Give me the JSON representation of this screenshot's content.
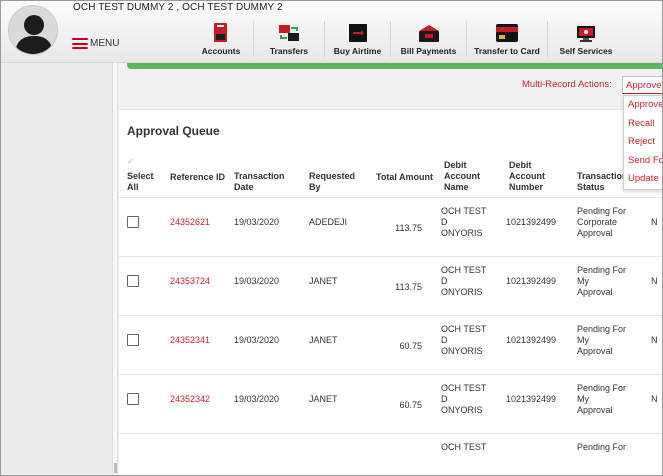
{
  "user": {
    "name": "OCH TEST DUMMY 2 , OCH TEST DUMMY 2"
  },
  "menu": {
    "label": "MENU"
  },
  "nav": [
    {
      "label": "Accounts",
      "icon": "accounts-icon"
    },
    {
      "label": "Transfers",
      "icon": "transfers-icon"
    },
    {
      "label": "Buy Airtime",
      "icon": "airtime-icon"
    },
    {
      "label": "Bill Payments",
      "icon": "bill-payments-icon"
    },
    {
      "label": "Transfer to Card",
      "icon": "card-icon"
    },
    {
      "label": "Self Services",
      "icon": "self-services-icon"
    }
  ],
  "multi_record": {
    "label": "Multi-Record Actions:",
    "selected": "Approve",
    "options": [
      "Approve",
      "Recall",
      "Reject",
      "Send For",
      "Update"
    ]
  },
  "queue": {
    "title": "Approval Queue",
    "columns": {
      "select": "Select All",
      "ref": "Reference ID",
      "date": "Transaction Date",
      "requested": "Requested By",
      "amount": "Total Amount",
      "debit_name": "Debit Account Name",
      "debit_number": "Debit Account Number",
      "status": "Transaction Status"
    },
    "rows": [
      {
        "ref": "24352621",
        "date": "19/03/2020",
        "requested": "ADEDEJI",
        "amount": "113.75",
        "name": [
          "OCH TEST",
          "D",
          "ONYORIS"
        ],
        "number": "1021392499",
        "status": [
          "Pending For",
          "Corporate",
          "Approval"
        ],
        "extra": "N"
      },
      {
        "ref": "24353724",
        "date": "19/03/2020",
        "requested": "JANET",
        "amount": "113.75",
        "name": [
          "OCH TEST",
          "D",
          "ONYORIS"
        ],
        "number": "1021392499",
        "status": [
          "Pending For",
          "My",
          "Approval"
        ],
        "extra": "N"
      },
      {
        "ref": "24352341",
        "date": "19/03/2020",
        "requested": "JANET",
        "amount": "60.75",
        "name": [
          "OCH TEST",
          "D",
          "ONYORIS"
        ],
        "number": "1021392499",
        "status": [
          "Pending For",
          "My",
          "Approval"
        ],
        "extra": "N"
      },
      {
        "ref": "24352342",
        "date": "19/03/2020",
        "requested": "JANET",
        "amount": "60.75",
        "name": [
          "OCH TEST",
          "D",
          "ONYORIS"
        ],
        "number": "1021392499",
        "status": [
          "Pending For",
          "My",
          "Approval"
        ],
        "extra": "N"
      },
      {
        "ref": "",
        "date": "",
        "requested": "",
        "amount": "",
        "name": [
          "OCH TEST",
          "",
          ""
        ],
        "number": "",
        "status": [
          "Pending For",
          "",
          ""
        ],
        "extra": ""
      }
    ]
  },
  "colors": {
    "accent": "#cc1f2b",
    "success": "#5cb85c"
  }
}
